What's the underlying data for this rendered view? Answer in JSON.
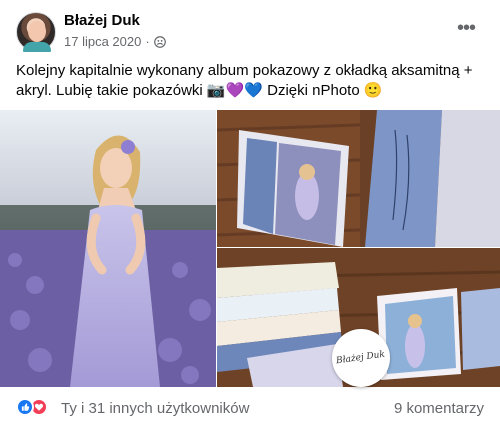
{
  "post": {
    "author": "Błażej Duk",
    "date": "17 lipca 2020",
    "separator": "·",
    "text": "Kolejny kapitalnie wykonany album pokazowy z okładką aksamitną + akryl. Lubię takie pokazówki 📷💜💙 Dzięki nPhoto 🙂",
    "audience_icon": "friends-icon",
    "more_icon": "more-horizontal-icon",
    "more_label": "•••"
  },
  "media": {
    "watermark_text": "Błażej Duk",
    "photos": [
      "woman-lavender-field",
      "photo-album-cover",
      "photo-album-pages"
    ]
  },
  "footer": {
    "reaction_icons": [
      "like-icon",
      "love-icon"
    ],
    "reactions_text": "Ty i 31 innych użytkowników",
    "comments_text": "9 komentarzy"
  },
  "colors": {
    "text_primary": "#050505",
    "text_secondary": "#65676b",
    "like_blue": "#1877f2",
    "love_red": "#f33e58"
  }
}
